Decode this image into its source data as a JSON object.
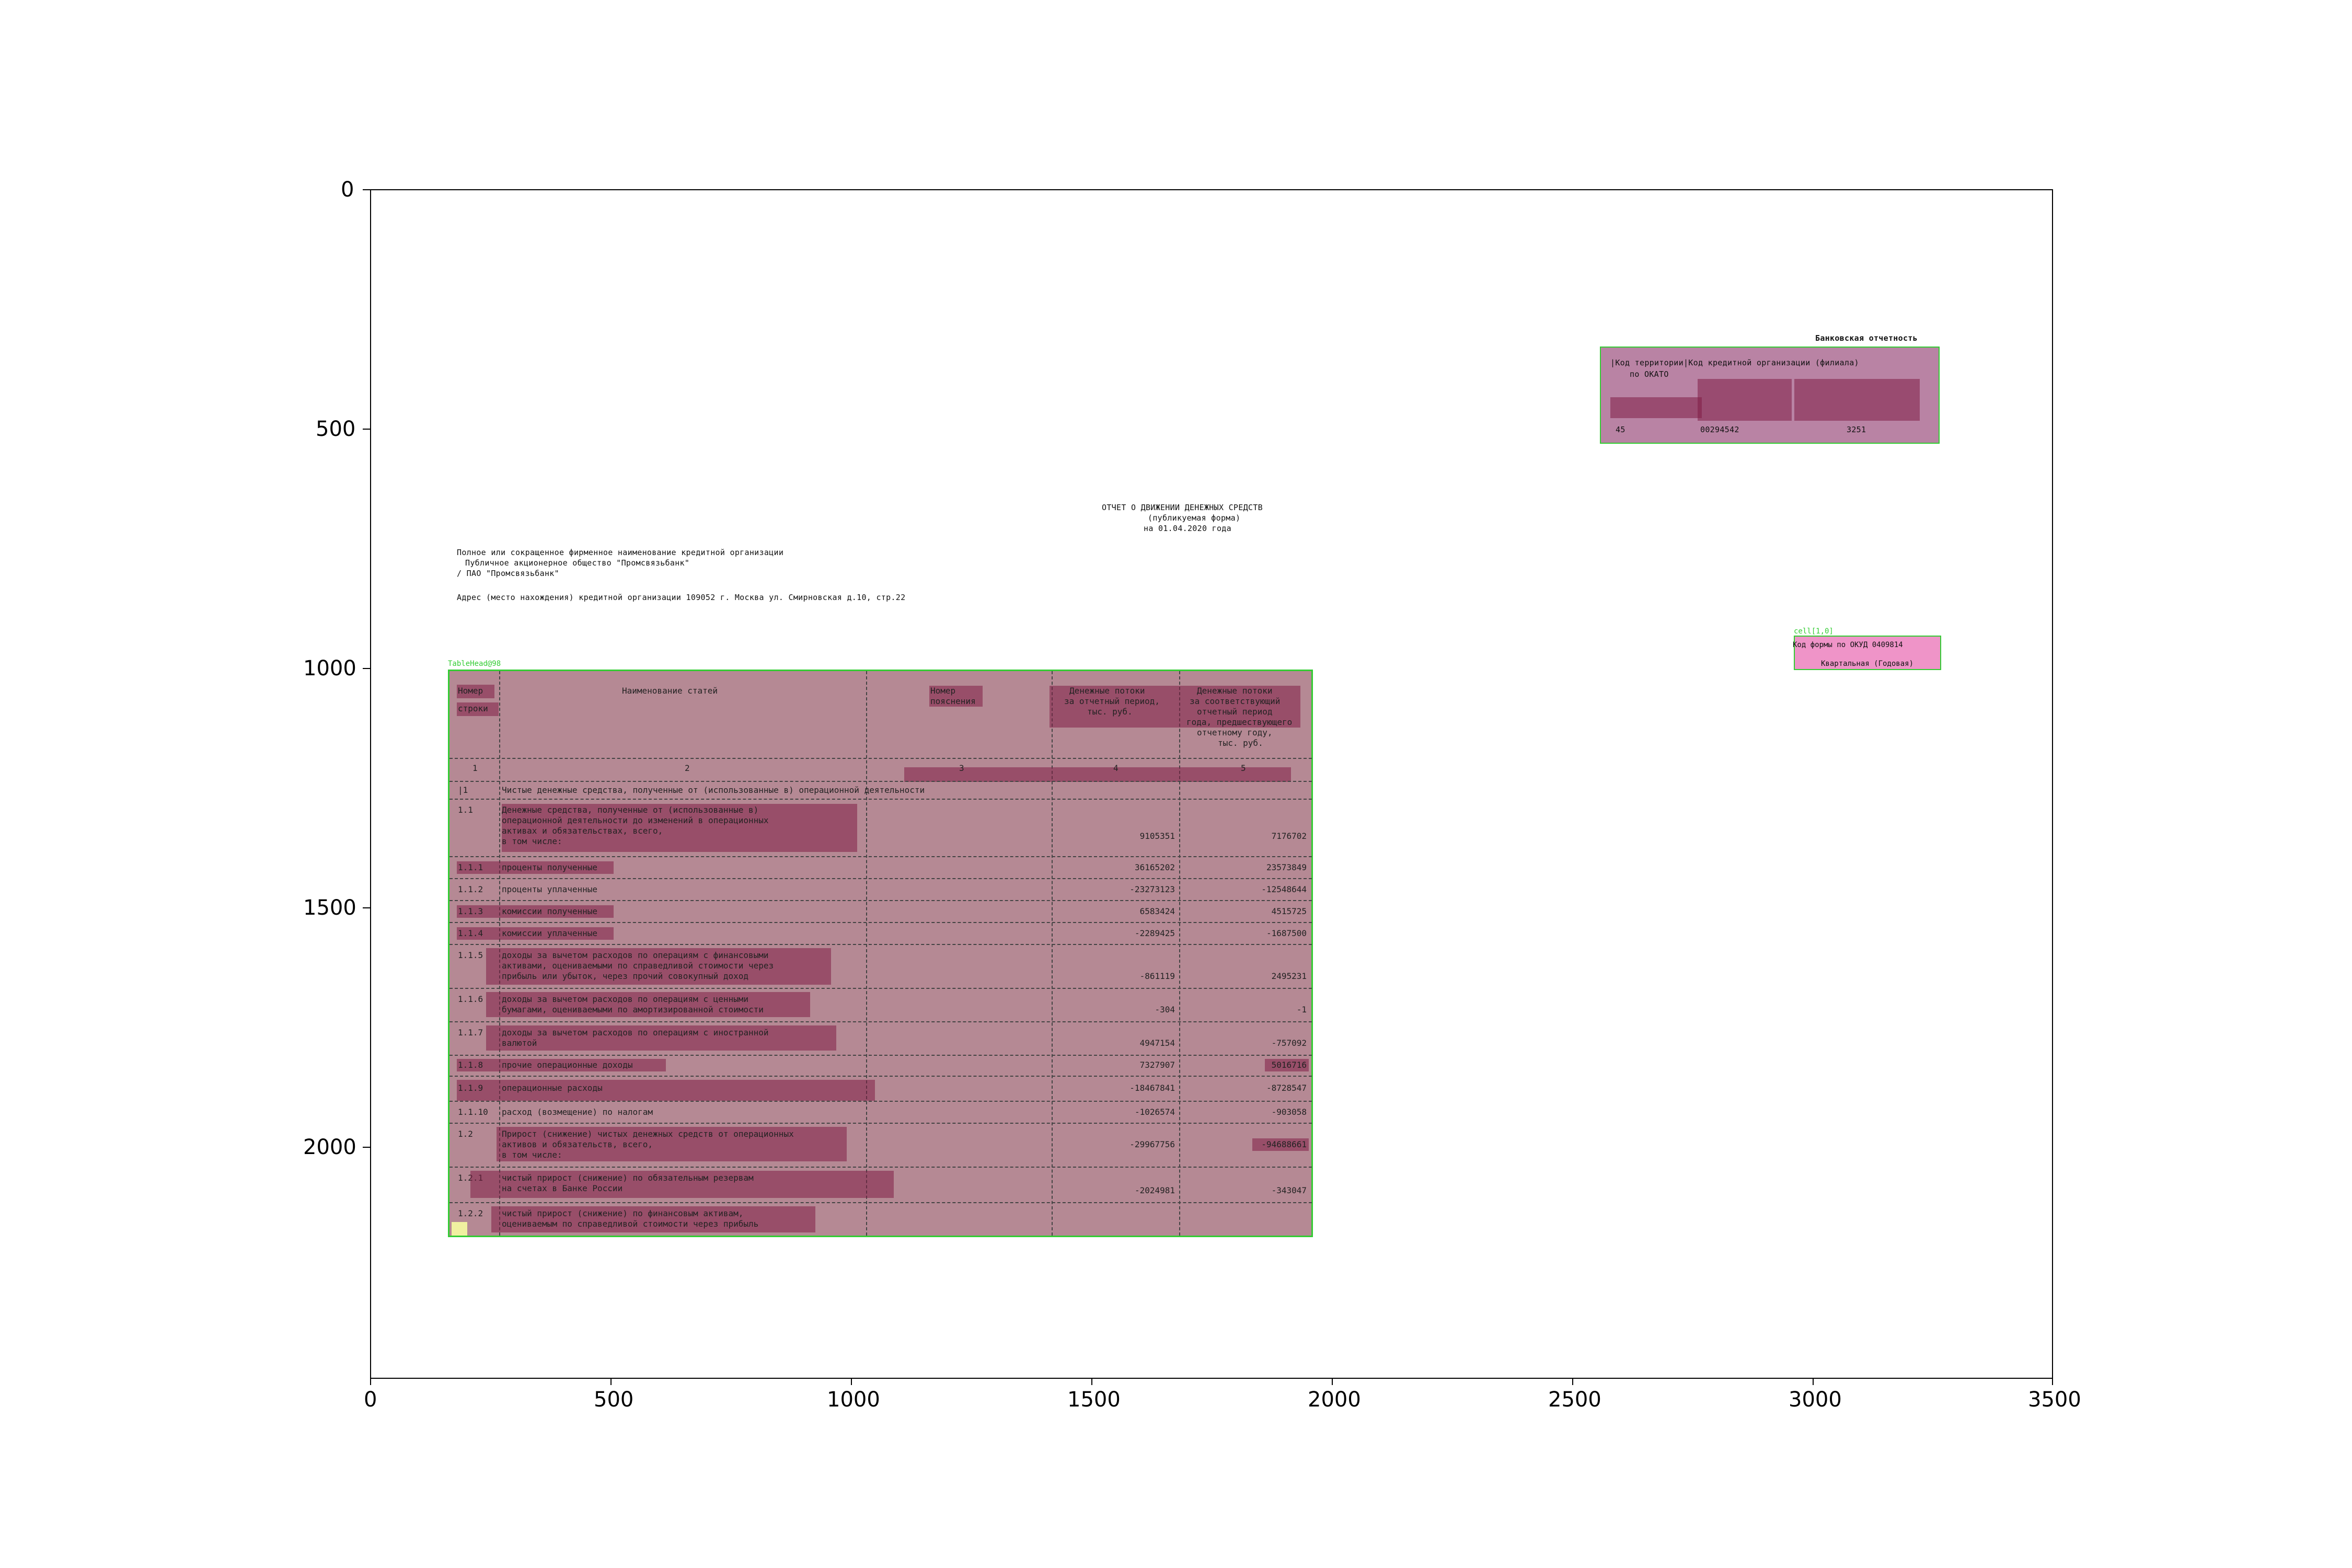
{
  "axes": {
    "x_ticks": [
      "0",
      "500",
      "1000",
      "1500",
      "2000",
      "2500",
      "3000",
      "3500"
    ],
    "y_ticks": [
      "0",
      "500",
      "1000",
      "1500",
      "2000"
    ]
  },
  "header": {
    "bank_reporting": "Банковская отчетность",
    "code_territory": "|Код территории|Код кредитной организации (филиала)",
    "okato": "по ОКАТО",
    "okato_value": "45",
    "reg_value": "00294542",
    "reg_num": "3251",
    "form_code": "Код формы по ОКУД 0409814",
    "form_period": "Квартальная (Годовая)"
  },
  "title": {
    "line1": "ОТЧЕТ О ДВИЖЕНИИ ДЕНЕЖНЫХ СРЕДСТВ",
    "line2": "(публикуемая форма)",
    "line3": "на  01.04.2020 года"
  },
  "org": {
    "name_label": "Полное или сокращенное фирменное наименование кредитной организации",
    "full_name": "Публичное акционерное общество \"Промсвязьбанк\"",
    "short_name": "/ ПАО \"Промсвязьбанк\"",
    "address": "Адрес (место нахождения) кредитной организации     109052 г. Москва ул. Смирновская д.10, стр.22"
  },
  "table": {
    "head": {
      "num": "Номер",
      "num2": "строки",
      "name": "Наименование статей",
      "note": "Номер",
      "note2": "пояснения",
      "cur_period": "Денежные потоки",
      "cur_period2": "за отчетный период,",
      "cur_period3": "тыс. руб.",
      "prev_period": "Денежные потоки",
      "prev_period2": "за соответствующий",
      "prev_period3": "отчетный период",
      "prev_period4": "года, предшествующего",
      "prev_period5": "отчетному году,",
      "prev_period6": "тыс. руб."
    },
    "col_numbers": [
      "1",
      "2",
      "3",
      "4",
      "5"
    ],
    "section1": "Чистые денежные средства, полученные от (использованные в) операционной деятельности",
    "rows": [
      {
        "num": "1.1",
        "name": "Денежные средства, полученные от (использованные в)",
        "name2": "операционной деятельности до изменений в операционных",
        "name3": "активах и обязательствах, всего,",
        "name4": "в том числе:",
        "cur": "9105351",
        "prev": "7176702"
      },
      {
        "num": "1.1.1",
        "name": "проценты полученные",
        "cur": "36165202",
        "prev": "23573849"
      },
      {
        "num": "1.1.2",
        "name": "проценты уплаченные",
        "cur": "-23273123",
        "prev": "-12548644"
      },
      {
        "num": "1.1.3",
        "name": "комиссии полученные",
        "cur": "6583424",
        "prev": "4515725"
      },
      {
        "num": "1.1.4",
        "name": "комиссии уплаченные",
        "cur": "-2289425",
        "prev": "-1687500"
      },
      {
        "num": "1.1.5",
        "name": "доходы за вычетом расходов по операциям с финансовыми",
        "name2": "активами, оцениваемыми по справедливой стоимости через",
        "name3": "прибыль или убыток, через прочий совокупный доход",
        "cur": "-861119",
        "prev": "2495231"
      },
      {
        "num": "1.1.6",
        "name": "доходы за вычетом расходов по операциям с ценными",
        "name2": "бумагами, оцениваемыми по амортизированной стоимости",
        "cur": "-304",
        "prev": "-1"
      },
      {
        "num": "1.1.7",
        "name": "доходы за вычетом расходов по операциям с иностранной",
        "name2": "валютой",
        "cur": "4947154",
        "prev": "-757092"
      },
      {
        "num": "1.1.8",
        "name": "прочие операционные доходы",
        "cur": "7327907",
        "prev": "5016716"
      },
      {
        "num": "1.1.9",
        "name": "операционные расходы",
        "cur": "-18467841",
        "prev": "-8728547"
      },
      {
        "num": "1.1.10",
        "name": "расход (возмещение) по налогам",
        "cur": "-1026574",
        "prev": "-903058"
      },
      {
        "num": "1.2",
        "name": "Прирост (снижение) чистых денежных средств от операционных",
        "name2": "активов и обязательств, всего,",
        "name3": "в том числе:",
        "cur": "-29967756",
        "prev": "-94688661"
      },
      {
        "num": "1.2.1",
        "name": "чистый прирост (снижение) по обязательным резервам",
        "name2": "на счетах в Банке России",
        "cur": "-2024981",
        "prev": "-343047"
      },
      {
        "num": "1.2.2",
        "name": "чистый прирост (снижение) по финансовым активам,",
        "name2": "оцениваемым по справедливой стоимости через прибыль",
        "cur": "",
        "prev": ""
      }
    ]
  },
  "annotation_labels": {
    "table_label": "TableHead@98",
    "form_label": "cell[1,0]"
  }
}
